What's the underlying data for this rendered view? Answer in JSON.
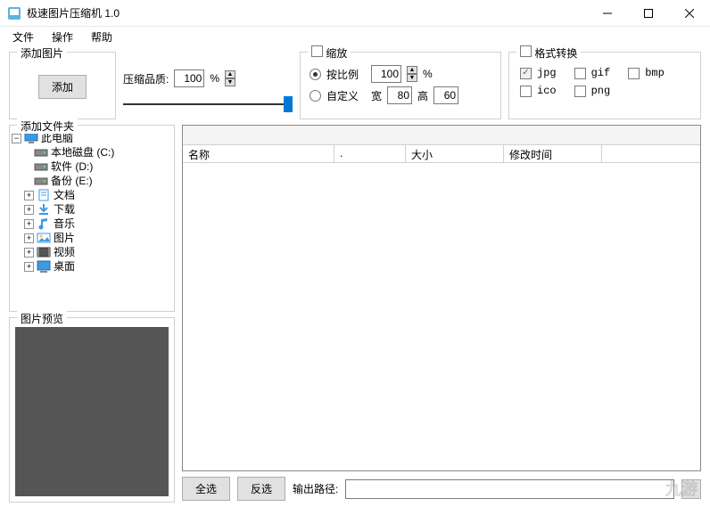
{
  "window": {
    "title": "极速图片压缩机 1.0"
  },
  "menu": {
    "file": "文件",
    "operation": "操作",
    "help": "帮助"
  },
  "addgroup": {
    "legend": "添加图片",
    "add_btn": "添加"
  },
  "quality": {
    "label": "压缩品质:",
    "value": "100",
    "unit": "%"
  },
  "scale": {
    "legend": "缩放",
    "by_ratio": "按比例",
    "ratio_value": "100",
    "ratio_unit": "%",
    "custom": "自定义",
    "width_label": "宽",
    "width_value": "80",
    "height_label": "高",
    "height_value": "60"
  },
  "format": {
    "legend": "格式转换",
    "jpg": "jpg",
    "gif": "gif",
    "bmp": "bmp",
    "ico": "ico",
    "png": "png"
  },
  "tree": {
    "legend": "添加文件夹",
    "root": "此电脑",
    "items": [
      {
        "label": "本地磁盘 (C:)",
        "icon": "drive"
      },
      {
        "label": "软件 (D:)",
        "icon": "drive"
      },
      {
        "label": "备份 (E:)",
        "icon": "drive"
      },
      {
        "label": "文档",
        "icon": "doc",
        "expandable": true
      },
      {
        "label": "下载",
        "icon": "download",
        "expandable": true
      },
      {
        "label": "音乐",
        "icon": "music",
        "expandable": true
      },
      {
        "label": "图片",
        "icon": "image",
        "expandable": true
      },
      {
        "label": "视频",
        "icon": "video",
        "expandable": true
      },
      {
        "label": "桌面",
        "icon": "desktop",
        "expandable": true
      }
    ]
  },
  "preview": {
    "legend": "图片预览"
  },
  "list": {
    "col_name": "名称",
    "col_dot": ".",
    "col_size": "大小",
    "col_mtime": "修改时间"
  },
  "bottom": {
    "select_all": "全选",
    "invert": "反选",
    "out_label": "输出路径:"
  },
  "watermark": "九游"
}
